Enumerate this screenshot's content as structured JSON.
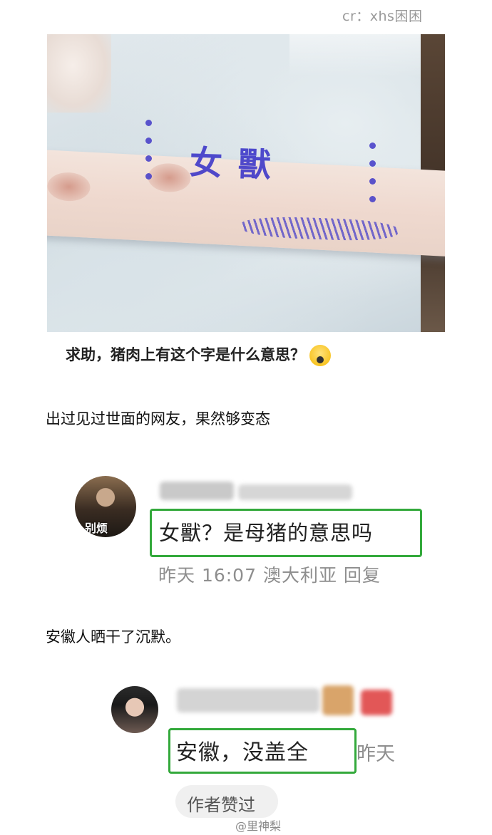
{
  "credit": "cr：xhs困困",
  "photo": {
    "stamp_text": "女獸"
  },
  "post": {
    "caption": "求助，猪肉上有这个字是什么意思？",
    "caption_emoji": "scream-emoji"
  },
  "paragraphs": {
    "first": "出过见过世面的网友，果然够变态",
    "second": "安徽人晒干了沉默。"
  },
  "comment1": {
    "avatar_label": "别烦",
    "text": "女獸？是母猪的意思吗",
    "meta": "昨天 16:07 澳大利亚 回复"
  },
  "comment2": {
    "text": "安徽，没盖全",
    "meta": "昨天",
    "liked_label": "作者赞过"
  },
  "watermark": "@里神梨",
  "colors": {
    "highlight_border": "#33a93b",
    "meta_text": "#8e8e8e",
    "ink": "#3a34c8"
  }
}
